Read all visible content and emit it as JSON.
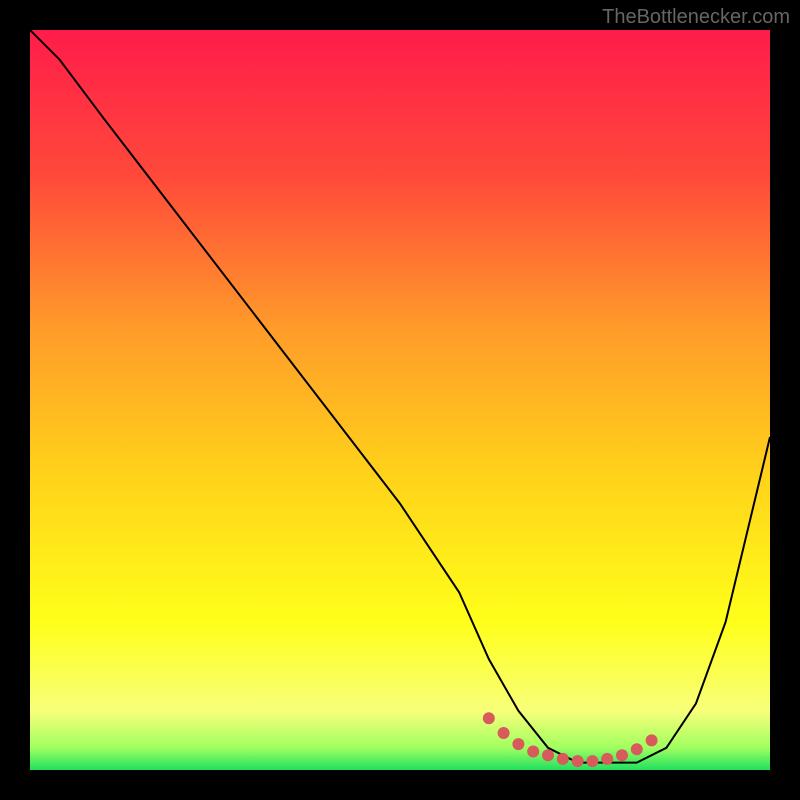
{
  "watermark": "TheBottlenecker.com",
  "chart_data": {
    "type": "line",
    "title": "",
    "xlabel": "",
    "ylabel": "",
    "xlim": [
      0,
      100
    ],
    "ylim": [
      0,
      100
    ],
    "grid": false,
    "gradient_stops": [
      {
        "offset": 0,
        "color": "#ff1c4a"
      },
      {
        "offset": 20,
        "color": "#ff4a3a"
      },
      {
        "offset": 40,
        "color": "#ff9a2a"
      },
      {
        "offset": 60,
        "color": "#ffd21a"
      },
      {
        "offset": 80,
        "color": "#ffff1a"
      },
      {
        "offset": 92,
        "color": "#f8ff7a"
      },
      {
        "offset": 97,
        "color": "#a0ff60"
      },
      {
        "offset": 100,
        "color": "#20e060"
      }
    ],
    "series": [
      {
        "name": "bottleneck-curve",
        "color": "#000000",
        "x": [
          0,
          4,
          10,
          20,
          30,
          40,
          50,
          58,
          62,
          66,
          70,
          74,
          78,
          82,
          86,
          90,
          94,
          100
        ],
        "y": [
          100,
          96,
          88,
          75,
          62,
          49,
          36,
          24,
          15,
          8,
          3,
          1,
          1,
          1,
          3,
          9,
          20,
          45
        ]
      }
    ],
    "highlight_points": {
      "name": "optimal-range",
      "color": "#d85a5a",
      "x": [
        62,
        64,
        66,
        68,
        70,
        72,
        74,
        76,
        78,
        80,
        82,
        84
      ],
      "y": [
        7,
        5,
        3.5,
        2.5,
        2,
        1.5,
        1.2,
        1.2,
        1.5,
        2,
        2.8,
        4
      ]
    }
  }
}
